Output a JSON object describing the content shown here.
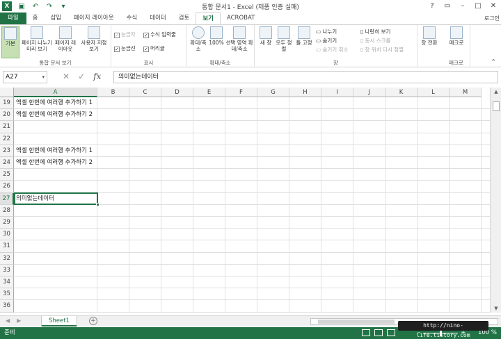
{
  "app": {
    "title": "통합 문서1 - Excel (제품 인증 실패)",
    "logo": "X",
    "login": "로그인"
  },
  "qat": [
    "save-icon",
    "undo-icon",
    "redo-icon",
    "customize-icon"
  ],
  "tabs": [
    {
      "label": "파일"
    },
    {
      "label": "홈"
    },
    {
      "label": "삽입"
    },
    {
      "label": "페이지 레이아웃"
    },
    {
      "label": "수식"
    },
    {
      "label": "데이터"
    },
    {
      "label": "검토"
    },
    {
      "label": "보기"
    },
    {
      "label": "ACROBAT"
    }
  ],
  "ribbon": {
    "groups": {
      "workbook_views": "통합 문서 보기",
      "show": "표시",
      "zoom": "확대/축소",
      "window": "창",
      "macros": "매크로"
    },
    "buttons": {
      "normal": "기본",
      "page_break": "페이지 나누기 미리 보기",
      "page_layout": "페이지 레이아웃",
      "custom_views": "사용자 지정 보기",
      "zoom": "확대/축소",
      "zoom100": "100%",
      "zoom_selection": "선택 영역 확대/축소",
      "new_window": "새 창",
      "arrange_all": "모두 정렬",
      "freeze": "틀 고정",
      "switch_windows": "창 전환",
      "macros": "매크로"
    },
    "checks": {
      "ruler": "눈금자",
      "formula_bar": "수식 입력줄",
      "gridlines": "눈금선",
      "headings": "머리글"
    },
    "window_small": {
      "split": "나누기",
      "hide": "숨기기",
      "unhide": "숨기기 취소",
      "side_by_side": "나란히 보기",
      "sync_scroll": "동시 스크롤",
      "reset_pos": "창 위치 다시 정렬"
    }
  },
  "formula": {
    "namebox": "A27",
    "cancel": "✕",
    "enter": "✓",
    "fx": "fx",
    "content": "의미없는데이터"
  },
  "columns": [
    "A",
    "B",
    "C",
    "D",
    "E",
    "F",
    "G",
    "H",
    "I",
    "J",
    "K",
    "L",
    "M"
  ],
  "rows": [
    {
      "num": "19",
      "a": "엑셀 한번에 여러행 추가하기 1"
    },
    {
      "num": "20",
      "a": "엑셀 한번에 여러행 추가하기 2"
    },
    {
      "num": "21",
      "a": ""
    },
    {
      "num": "22",
      "a": ""
    },
    {
      "num": "23",
      "a": "엑셀 한번에 여러행 추가하기 1"
    },
    {
      "num": "24",
      "a": "엑셀 한번에 여러행 추가하기 2"
    },
    {
      "num": "25",
      "a": ""
    },
    {
      "num": "26",
      "a": ""
    },
    {
      "num": "27",
      "a": "의미없는데이터"
    },
    {
      "num": "28",
      "a": ""
    },
    {
      "num": "29",
      "a": ""
    },
    {
      "num": "30",
      "a": ""
    },
    {
      "num": "31",
      "a": ""
    },
    {
      "num": "32",
      "a": ""
    },
    {
      "num": "33",
      "a": ""
    },
    {
      "num": "34",
      "a": ""
    },
    {
      "num": "35",
      "a": ""
    },
    {
      "num": "36",
      "a": ""
    }
  ],
  "sheet": {
    "tab": "Sheet1",
    "add": "+"
  },
  "status": {
    "ready": "준비",
    "zoom": "100 %"
  },
  "watermark": "http://nino-life.tistory.com"
}
